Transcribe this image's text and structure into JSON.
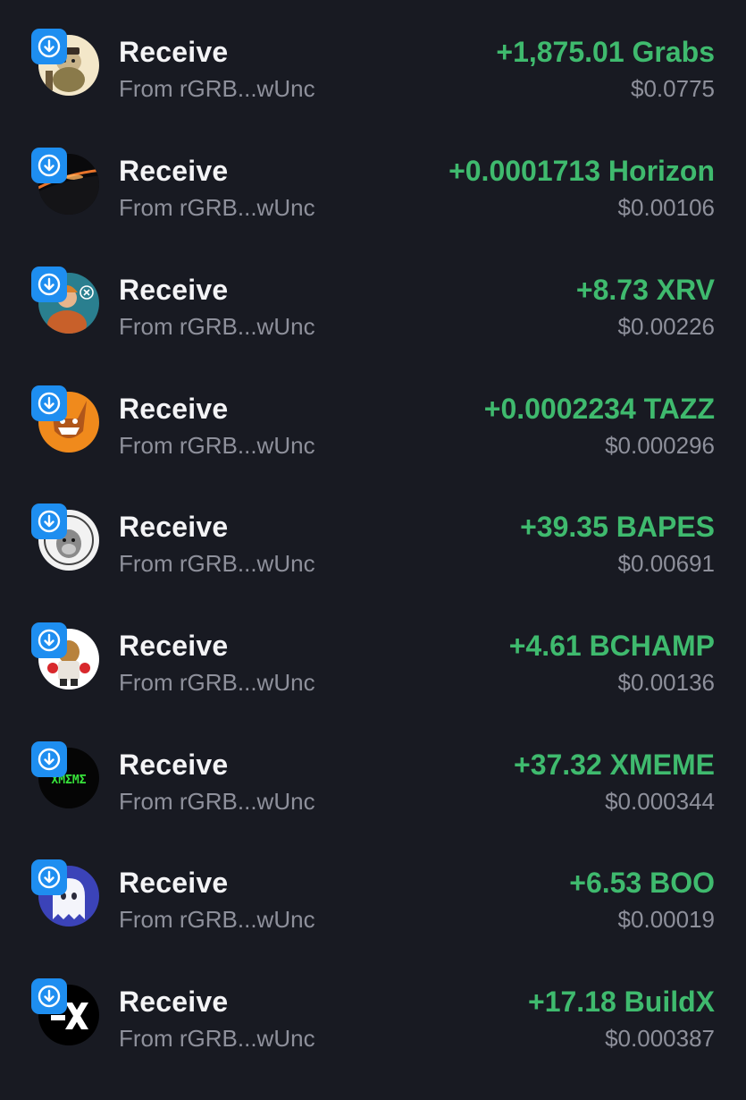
{
  "colors": {
    "background": "#181a22",
    "amount_positive": "#3fba6e",
    "secondary_text": "#8e909b",
    "badge": "#1e8ef0"
  },
  "transactions": [
    {
      "title": "Receive",
      "from": "From rGRB...wUnc",
      "amount": "+1,875.01 Grabs",
      "fiat": "$0.0775",
      "avatar": "grabs-token-icon",
      "badge": "receive-arrow-icon"
    },
    {
      "title": "Receive",
      "from": "From rGRB...wUnc",
      "amount": "+0.0001713 Horizon",
      "fiat": "$0.00106",
      "avatar": "horizon-token-icon",
      "badge": "receive-arrow-icon"
    },
    {
      "title": "Receive",
      "from": "From rGRB...wUnc",
      "amount": "+8.73 XRV",
      "fiat": "$0.00226",
      "avatar": "xrv-token-icon",
      "badge": "receive-arrow-icon"
    },
    {
      "title": "Receive",
      "from": "From rGRB...wUnc",
      "amount": "+0.0002234 TAZZ",
      "fiat": "$0.000296",
      "avatar": "tazz-token-icon",
      "badge": "receive-arrow-icon"
    },
    {
      "title": "Receive",
      "from": "From rGRB...wUnc",
      "amount": "+39.35 BAPES",
      "fiat": "$0.00691",
      "avatar": "bapes-token-icon",
      "badge": "receive-arrow-icon"
    },
    {
      "title": "Receive",
      "from": "From rGRB...wUnc",
      "amount": "+4.61 BCHAMP",
      "fiat": "$0.00136",
      "avatar": "bchamp-token-icon",
      "badge": "receive-arrow-icon"
    },
    {
      "title": "Receive",
      "from": "From rGRB...wUnc",
      "amount": "+37.32 XMEME",
      "fiat": "$0.000344",
      "avatar": "xmeme-token-icon",
      "avatar_text": "XMΣMΣ",
      "badge": "receive-arrow-icon"
    },
    {
      "title": "Receive",
      "from": "From rGRB...wUnc",
      "amount": "+6.53 BOO",
      "fiat": "$0.00019",
      "avatar": "boo-token-icon",
      "badge": "receive-arrow-icon"
    },
    {
      "title": "Receive",
      "from": "From rGRB...wUnc",
      "amount": "+17.18 BuildX",
      "fiat": "$0.000387",
      "avatar": "buildx-token-icon",
      "badge": "receive-arrow-icon"
    }
  ]
}
